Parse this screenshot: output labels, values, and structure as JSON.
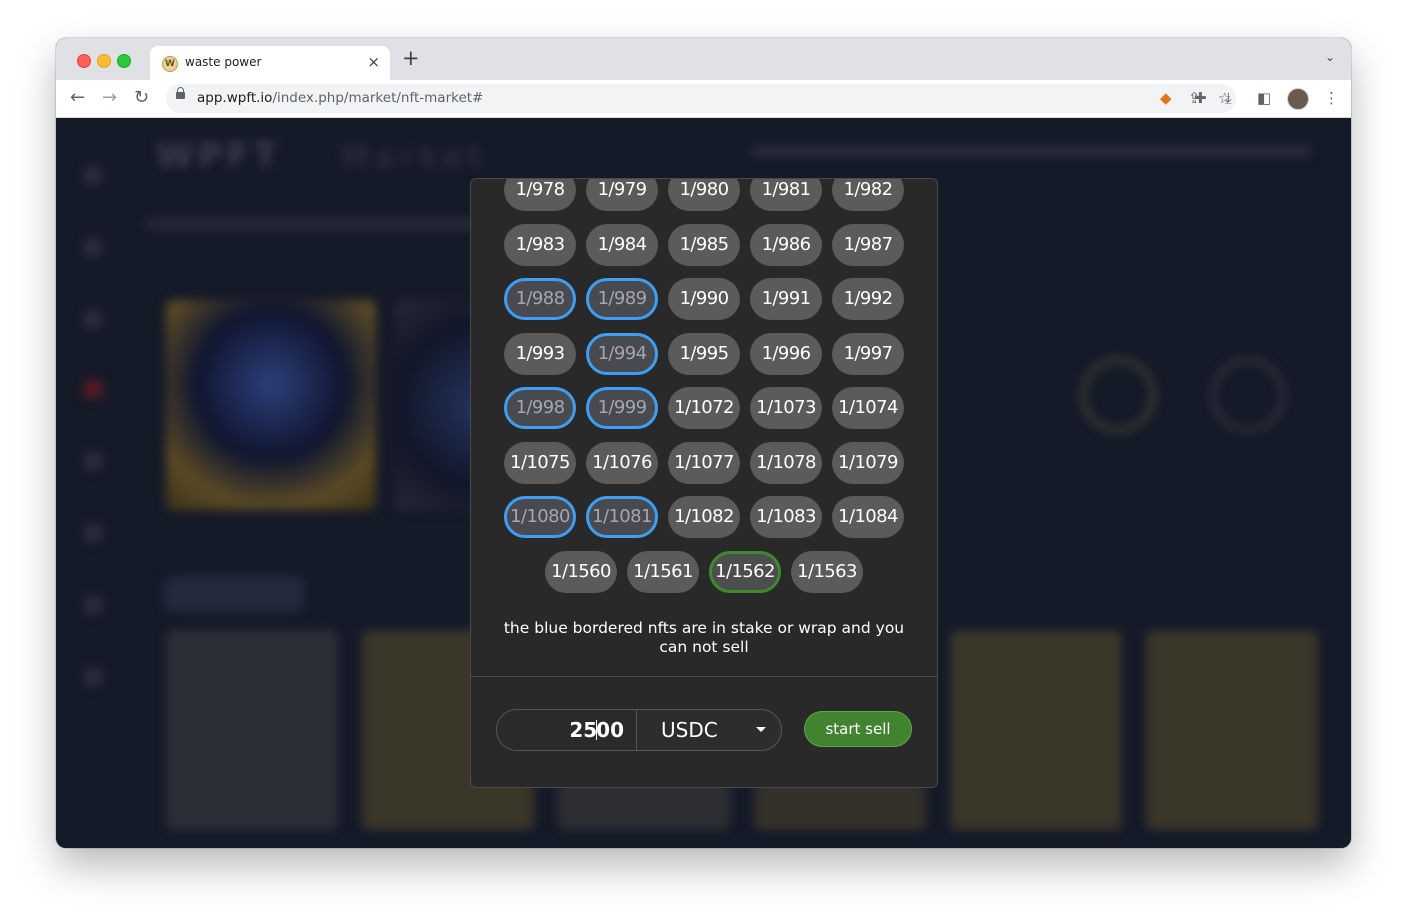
{
  "browser": {
    "tab_title": "waste power",
    "tab_favicon_letter": "W",
    "tab_close": "×",
    "new_tab": "+",
    "url_host": "app.wpft.io",
    "url_path": "/index.php/market/nft-market#"
  },
  "page": {
    "logo_text": "WPFT",
    "title_text": "Market"
  },
  "modal": {
    "nft_rows": [
      [
        "1/978",
        "1/979",
        "1/980",
        "1/981",
        "1/982"
      ],
      [
        "1/983",
        "1/984",
        "1/985",
        "1/986",
        "1/987"
      ],
      [
        "1/988",
        "1/989",
        "1/990",
        "1/991",
        "1/992"
      ],
      [
        "1/993",
        "1/994",
        "1/995",
        "1/996",
        "1/997"
      ],
      [
        "1/998",
        "1/999",
        "1/1072",
        "1/1073",
        "1/1074"
      ],
      [
        "1/1075",
        "1/1076",
        "1/1077",
        "1/1078",
        "1/1079"
      ],
      [
        "1/1080",
        "1/1081",
        "1/1082",
        "1/1083",
        "1/1084"
      ],
      [
        "1/1560",
        "1/1561",
        "1/1562",
        "1/1563"
      ]
    ],
    "blue_bordered": [
      "1/988",
      "1/989",
      "1/994",
      "1/998",
      "1/999",
      "1/1080",
      "1/1081"
    ],
    "selected": [
      "1/1562"
    ],
    "notice": "the blue bordered nfts are in stake or wrap and you can not sell",
    "price_before_cursor": "25",
    "price_after_cursor": "00",
    "currency": "USDC",
    "start_button": "start sell"
  },
  "colors": {
    "blue_border": "#3d9ef5",
    "green_border": "#3d8a2e",
    "start_button": "#41832f",
    "chip": "#5b5b5b",
    "modal": "#292929"
  },
  "icons": {
    "back": "back-arrow-icon",
    "forward": "forward-arrow-icon",
    "reload": "reload-icon",
    "lock": "lock-icon",
    "share": "share-icon",
    "bookmark": "star-icon",
    "extension_fox": "metamask-icon",
    "extensions": "puzzle-icon",
    "download": "download-icon",
    "side_panel": "side-panel-icon",
    "menu": "kebab-menu-icon"
  }
}
